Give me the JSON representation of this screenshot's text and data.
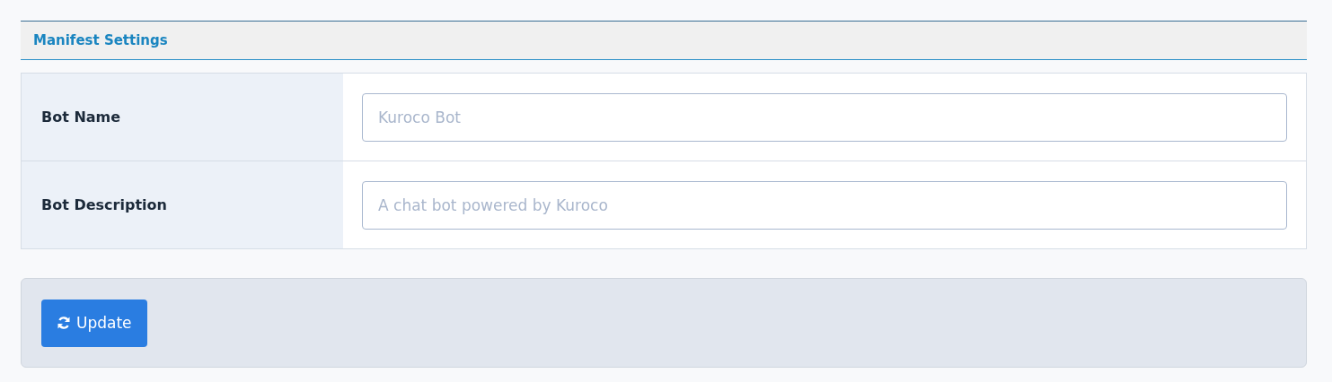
{
  "section": {
    "title": "Manifest Settings"
  },
  "fields": [
    {
      "label": "Bot Name",
      "placeholder": "Kuroco Bot"
    },
    {
      "label": "Bot Description",
      "placeholder": "A chat bot powered by Kuroco"
    }
  ],
  "footer": {
    "button": "Update"
  }
}
